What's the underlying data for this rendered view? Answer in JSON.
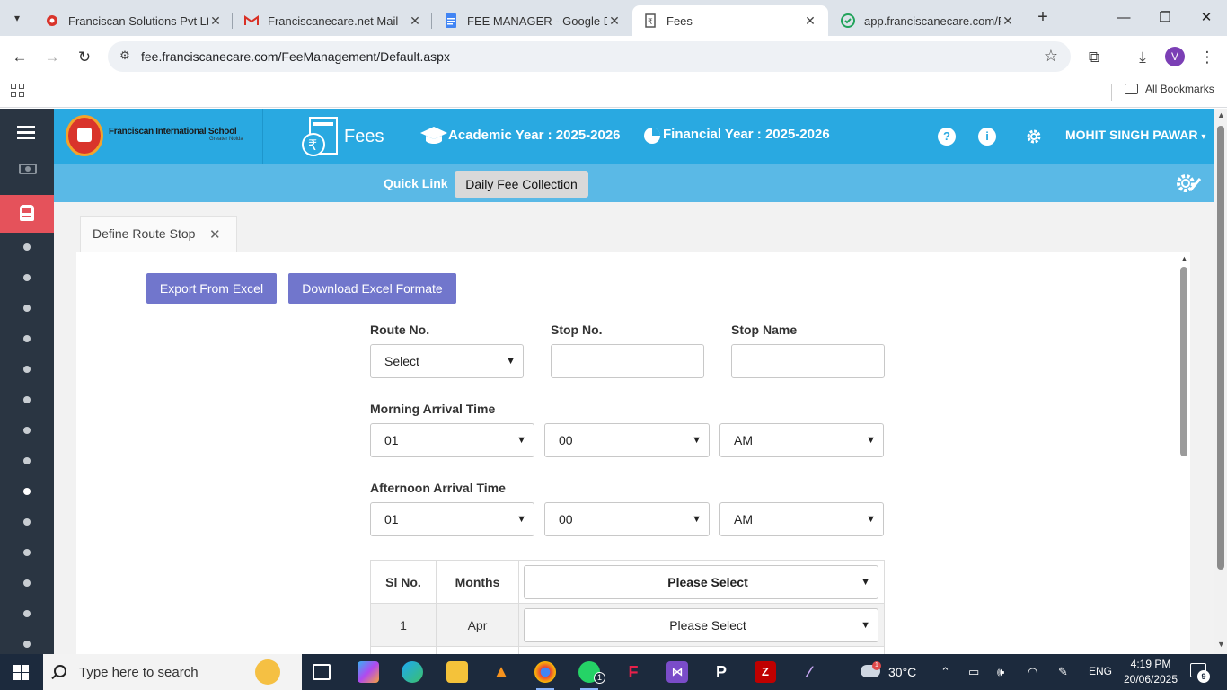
{
  "browser": {
    "tabs": [
      {
        "label": "Franciscan Solutions Pvt Ltd.",
        "icon": "franciscan-favicon"
      },
      {
        "label": "Franciscanecare.net Mail",
        "icon": "gmail-icon"
      },
      {
        "label": "FEE MANAGER - Google Docs",
        "icon": "google-docs-icon"
      },
      {
        "label": "Fees",
        "icon": "fees-favicon"
      },
      {
        "label": "app.franciscanecare.com/Po",
        "icon": "ecare-favicon"
      }
    ],
    "active_tab_index": 3,
    "url": "fee.franciscanecare.com/FeeManagement/Default.aspx",
    "profile_initial": "V",
    "bookmarks_label": "All Bookmarks"
  },
  "header": {
    "school_name": "Franciscan International School",
    "school_sub": "Greater Noida",
    "module_title": "Fees",
    "academic_year": "Academic Year : 2025-2026",
    "financial_year": "Financial Year : 2025-2026",
    "user_name": "MOHIT SINGH PAWAR",
    "help_glyph": "?",
    "info_glyph": "i"
  },
  "quick_link": {
    "label": "Quick Link",
    "button": "Daily Fee Collection"
  },
  "page_tab": {
    "label": "Define Route Stop",
    "close": "✕"
  },
  "actions": {
    "export": "Export From Excel",
    "download": "Download Excel Formate"
  },
  "form": {
    "route_label": "Route No.",
    "route_value": "Select",
    "stop_no_label": "Stop No.",
    "stop_name_label": "Stop Name",
    "morning_label": "Morning Arrival Time",
    "morning_hour": "01",
    "morning_min": "00",
    "morning_ampm": "AM",
    "afternoon_label": "Afternoon Arrival Time",
    "afternoon_hour": "01",
    "afternoon_min": "00",
    "afternoon_ampm": "AM"
  },
  "months_table": {
    "headers": [
      "Sl No.",
      "Months"
    ],
    "header_select": "Please Select",
    "rows": [
      {
        "sl": "1",
        "month": "Apr",
        "select": "Please Select"
      }
    ]
  },
  "taskbar": {
    "search_placeholder": "Type here to search",
    "temperature": "30°C",
    "language": "ENG",
    "time": "4:19 PM",
    "date": "20/06/2025",
    "whatsapp_badge": "1",
    "notification_count": "9",
    "weather_badge": "1"
  },
  "colors": {
    "header_blue": "#29a9e1",
    "quickbar_blue": "#5ab9e6",
    "sidebar_dark": "#2a3542",
    "active_red": "#e5525b",
    "button_purple": "#7176cc"
  }
}
